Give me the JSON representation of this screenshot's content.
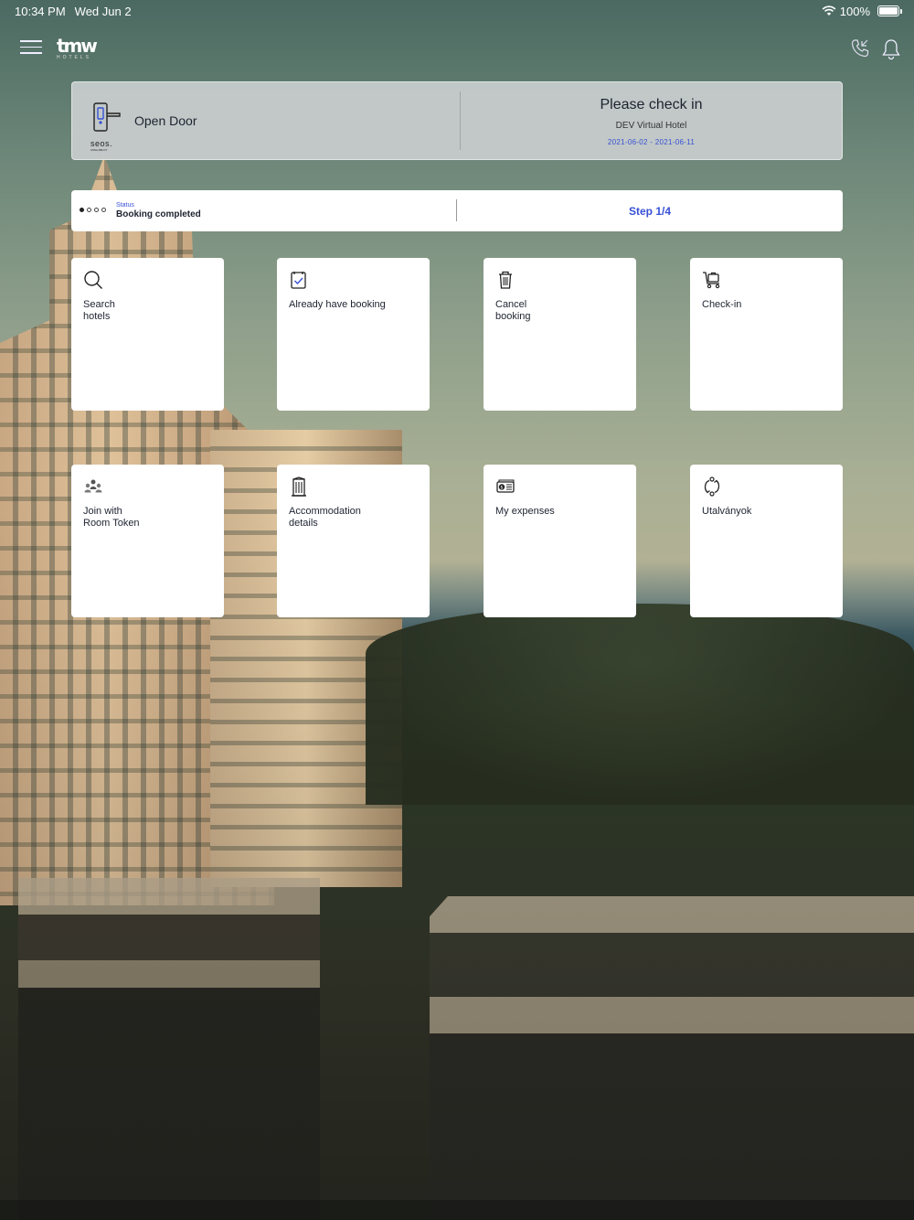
{
  "status_bar": {
    "time": "10:34 PM",
    "date": "Wed Jun 2",
    "battery": "100%",
    "icons": [
      "wifi-icon",
      "battery-icon"
    ]
  },
  "app_header": {
    "logo_text": "tmw",
    "logo_sub": "HOTELS",
    "icons": [
      "menu-icon",
      "phone-icon",
      "bell-icon"
    ]
  },
  "door_card": {
    "open_door_label": "Open Door",
    "brand": "seos.",
    "brand_sub": "ASSA ABLOY",
    "checkin_title": "Please check in",
    "hotel_name": "DEV Virtual Hotel",
    "dates": "2021-06-02 - 2021-06-11"
  },
  "progress": {
    "status_label": "Status",
    "status_value": "Booking completed",
    "step_label": "Step 1/4",
    "steps_total": 4,
    "steps_completed": 1,
    "accent_color": "#3850d6"
  },
  "tiles": [
    {
      "line1": "Search",
      "line2": "hotels",
      "icon": "search-icon"
    },
    {
      "line1": "Already have booking",
      "line2": "",
      "icon": "booking-check-icon"
    },
    {
      "line1": "Cancel",
      "line2": "booking",
      "icon": "trash-icon"
    },
    {
      "line1": "Check-in",
      "line2": "",
      "icon": "luggage-cart-icon"
    },
    {
      "line1": "Join with",
      "line2": "Room Token",
      "icon": "group-icon"
    },
    {
      "line1": "Accommodation",
      "line2": "details",
      "icon": "building-icon"
    },
    {
      "line1": "My expenses",
      "line2": "",
      "icon": "money-icon"
    },
    {
      "line1": "Utalványok",
      "line2": "",
      "icon": "exchange-icon"
    }
  ]
}
